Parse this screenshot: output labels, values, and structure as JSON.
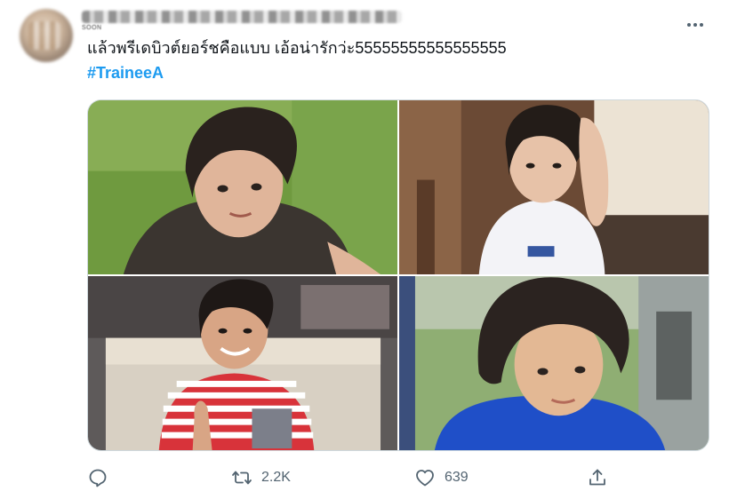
{
  "tweet": {
    "handle_fragment": "SOON",
    "text": "แล้วพรีเดบิวต์ยอร์ชคือแบบ เอ้อน่ารักว่ะ55555555555555555",
    "hashtag": "#TraineeA"
  },
  "icons": {
    "more": "more-horizontal-icon",
    "reply": "reply-icon",
    "retweet": "retweet-icon",
    "like": "heart-icon",
    "share": "share-icon"
  },
  "actions": {
    "retweet_count": "2.2K",
    "like_count": "639"
  },
  "colors": {
    "link": "#1d9bf0",
    "icon": "#536471",
    "text": "#0f1419"
  }
}
